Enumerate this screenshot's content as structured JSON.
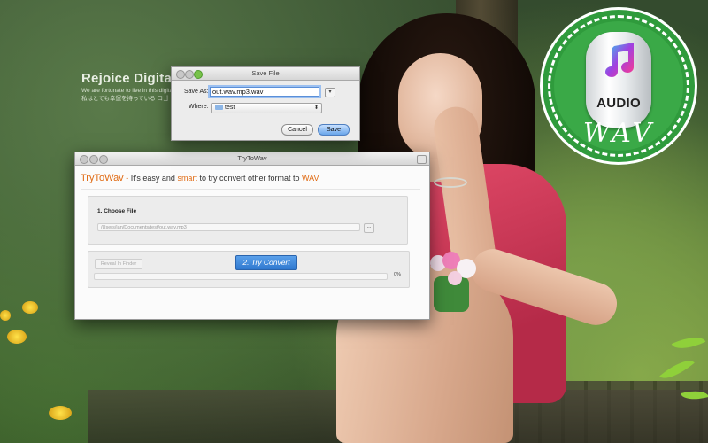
{
  "desktop": {
    "logo_text": "Rejoice Digital",
    "tagline_en": "We are fortunate to live in this digital age",
    "tagline_jp": "私はとても幸運を持っている ロゴ"
  },
  "badge": {
    "icon": "music-note-icon",
    "audio_label": "AUDIO",
    "format_label": "WAV",
    "colors": {
      "green": "#2f9b3c",
      "ring": "#ffffff"
    }
  },
  "save_dialog": {
    "title": "Save File",
    "save_as_label": "Save As:",
    "filename_value": "out.wav.mp3.wav",
    "where_label": "Where:",
    "where_value": "test",
    "cancel_label": "Cancel",
    "save_label": "Save"
  },
  "main_window": {
    "title": "TryToWav",
    "headline": {
      "brand": "TryToWav",
      "dash": " - ",
      "part1": "It's easy and ",
      "smart": "smart",
      "part2": " to try convert other format to ",
      "wav": "WAV"
    },
    "step1_title": "1. Choose File",
    "file_path": "/Users/ian/Documents/test/out.wav.mp3",
    "browse_label": "...",
    "reveal_label": "Reveal In Finder",
    "convert_label": "2. Try Convert",
    "progress": {
      "value": 0,
      "label": "0%"
    },
    "accent_color": "#e06a12",
    "button_color": "#2f78cf"
  }
}
